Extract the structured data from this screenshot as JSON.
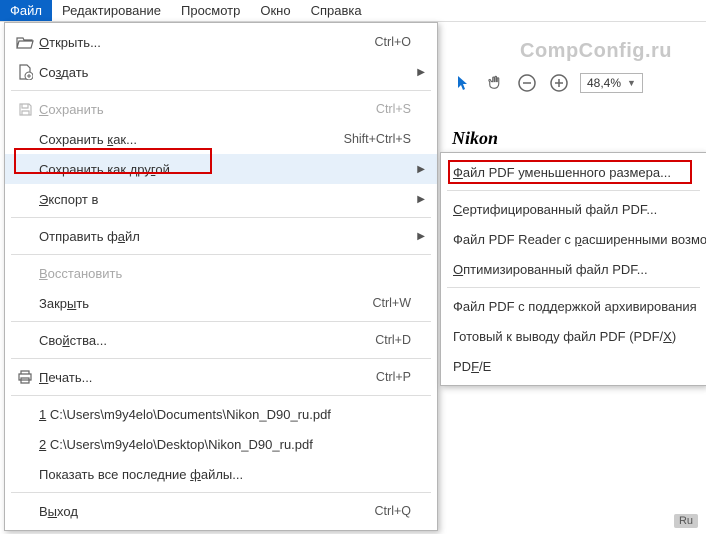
{
  "menubar": {
    "items": [
      "Файл",
      "Редактирование",
      "Просмотр",
      "Окно",
      "Справка"
    ]
  },
  "watermark": "CompConfig.ru",
  "zoom": {
    "value": "48,4%"
  },
  "doc_brand": "Nikon",
  "dropdown": {
    "open": {
      "label_pre": "",
      "u": "О",
      "label_post": "ткрыть...",
      "shortcut": "Ctrl+O"
    },
    "create": {
      "label_pre": "Со",
      "u": "з",
      "label_post": "дать"
    },
    "save": {
      "label_pre": "",
      "u": "С",
      "label_post": "охранить",
      "shortcut": "Ctrl+S"
    },
    "saveas": {
      "label_pre": "Сохранить ",
      "u": "к",
      "label_post": "ак...",
      "shortcut": "Shift+Ctrl+S"
    },
    "saveother": {
      "label_pre": "Сохранить как дру",
      "u": "г",
      "label_post": "ой"
    },
    "export": {
      "label_pre": "",
      "u": "Э",
      "label_post": "кспорт в"
    },
    "send": {
      "label_pre": "Отправить ф",
      "u": "а",
      "label_post": "йл"
    },
    "restore": {
      "label_pre": "",
      "u": "В",
      "label_post": "осстановить"
    },
    "close": {
      "label_pre": "Закр",
      "u": "ы",
      "label_post": "ть",
      "shortcut": "Ctrl+W"
    },
    "props": {
      "label_pre": "Сво",
      "u": "й",
      "label_post": "ства...",
      "shortcut": "Ctrl+D"
    },
    "print": {
      "label_pre": "",
      "u": "П",
      "label_post": "ечать...",
      "shortcut": "Ctrl+P"
    },
    "recent1": {
      "u": "1",
      "label": " C:\\Users\\m9y4elo\\Documents\\Nikon_D90_ru.pdf"
    },
    "recent2": {
      "u": "2",
      "label": " C:\\Users\\m9y4elo\\Desktop\\Nikon_D90_ru.pdf"
    },
    "showall": {
      "label_pre": "Показать все последние ",
      "u": "ф",
      "label_post": "айлы..."
    },
    "exit": {
      "label_pre": "В",
      "u": "ы",
      "label_post": "ход",
      "shortcut": "Ctrl+Q"
    }
  },
  "submenu": {
    "reduced": {
      "u": "Ф",
      "rest": "айл PDF уменьшенного размера..."
    },
    "certified": {
      "u": "С",
      "rest": "ертифицированный файл PDF..."
    },
    "reader": {
      "pre": "Файл PDF Reader с ",
      "u": "р",
      "rest": "асширенными возможностями"
    },
    "optimized": {
      "u": "О",
      "rest": "птимизированный файл PDF..."
    },
    "archive": {
      "label": "Файл PDF с поддержкой архивирования"
    },
    "printready": {
      "pre": "Готовый к выводу файл PDF (PDF/",
      "u": "X",
      "rest": ")"
    },
    "pdfe": {
      "pre": "PD",
      "u": "F",
      "rest": "/E"
    }
  },
  "badge": "Ru"
}
